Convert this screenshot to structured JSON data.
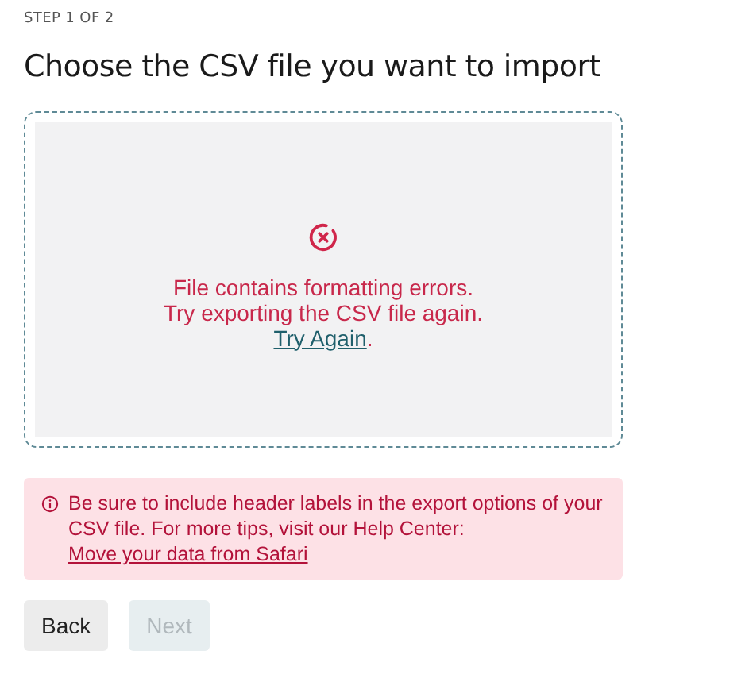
{
  "step": "STEP 1 OF 2",
  "title": "Choose the CSV file you want to import",
  "dropzone": {
    "error": true,
    "message_lines": [
      "File contains formatting errors.",
      "Try exporting the CSV file again."
    ],
    "link": "Try Again",
    "suffix": "."
  },
  "notice": {
    "text": "Be sure to include header labels in the export options of your CSV file. For more tips, visit our Help Center: ",
    "link": "Move your data from Safari"
  },
  "buttons": [
    {
      "label": "Back",
      "disabled": false
    },
    {
      "label": "Next",
      "disabled": true
    }
  ]
}
